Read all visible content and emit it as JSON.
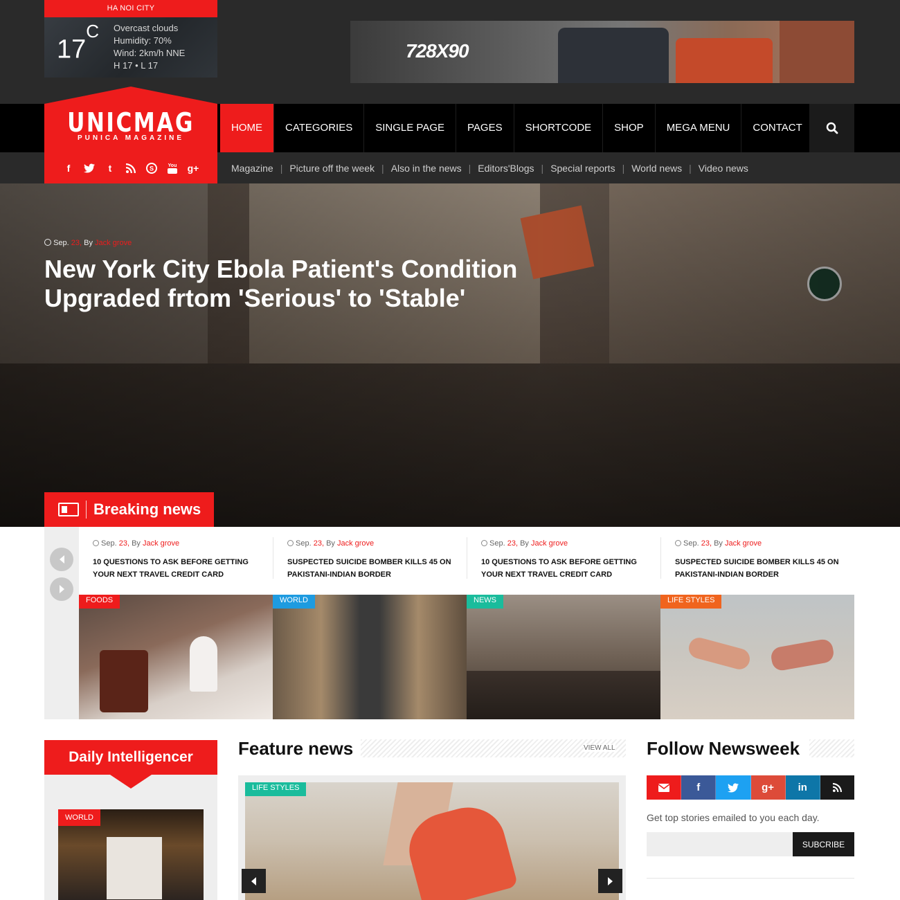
{
  "weather": {
    "city": "HA NOI CITY",
    "temp": "17",
    "unit": "C",
    "condition": "Overcast clouds",
    "humidity": "Humidity: 70%",
    "wind": "Wind: 2km/h NNE",
    "range": "H 17 • L 17"
  },
  "ad": {
    "label": "728X90"
  },
  "logo": {
    "name": "UNICMAG",
    "tagline": "PUNICA MAGAZINE"
  },
  "menu": [
    {
      "label": "HOME",
      "active": true
    },
    {
      "label": "CATEGORIES"
    },
    {
      "label": "SINGLE PAGE"
    },
    {
      "label": "PAGES"
    },
    {
      "label": "SHORTCODE"
    },
    {
      "label": "SHOP"
    },
    {
      "label": "MEGA MENU"
    },
    {
      "label": "CONTACT"
    }
  ],
  "social": [
    "f",
    "t",
    "t",
    "rss",
    "s",
    "yt",
    "g+"
  ],
  "sublinks": [
    "Magazine",
    "Picture off the week",
    "Also in the news",
    "Editors'Blogs",
    "Special reports",
    "World news",
    "Video news"
  ],
  "hero": {
    "meta_prefix": "Sep.",
    "meta_day": "23,",
    "meta_by": "By",
    "meta_author": "Jack grove",
    "title": "New York City Ebola Patient's Condition Upgraded frtom 'Serious' to 'Stable'"
  },
  "breaking": {
    "label": "Breaking news"
  },
  "breaking_items": [
    {
      "month": "Sep.",
      "day": "23,",
      "by": "By",
      "author": "Jack grove",
      "title": "10 questions to ask before getting your next travel credit card"
    },
    {
      "month": "Sep.",
      "day": "23,",
      "by": "By",
      "author": "Jack grove",
      "title": "Suspected suicide bomber kills 45 on pakistani-indian border"
    },
    {
      "month": "Sep.",
      "day": "23,",
      "by": "By",
      "author": "Jack grove",
      "title": "10 questions to ask before getting your next travel credit card"
    },
    {
      "month": "Sep.",
      "day": "23,",
      "by": "By",
      "author": "Jack grove",
      "title": "Suspected suicide bomber kills 45 on pakistani-indian border"
    }
  ],
  "thumbs": [
    {
      "category": "FOODS",
      "color": "#ee1c1c"
    },
    {
      "category": "WORLD",
      "color": "#1e9be0"
    },
    {
      "category": "NEWS",
      "color": "#1abc9c"
    },
    {
      "category": "LIFE STYLES",
      "color": "#f0641e"
    }
  ],
  "daily": {
    "title": "Daily Intelligencer",
    "category": "WORLD"
  },
  "feature": {
    "title": "Feature news",
    "view_all": "VIEW ALL",
    "category": "LIFE STYLES"
  },
  "follow": {
    "title": "Follow Newsweek",
    "icons": [
      {
        "name": "email",
        "color": "#ee1c1c"
      },
      {
        "name": "facebook",
        "color": "#3b5998"
      },
      {
        "name": "twitter",
        "color": "#1da1f2"
      },
      {
        "name": "google-plus",
        "color": "#dd4b39"
      },
      {
        "name": "linkedin",
        "color": "#0e76a8"
      },
      {
        "name": "rss",
        "color": "#1a1a1a"
      }
    ],
    "text": "Get top stories emailed to you each day.",
    "button": "SUBCRIBE"
  }
}
